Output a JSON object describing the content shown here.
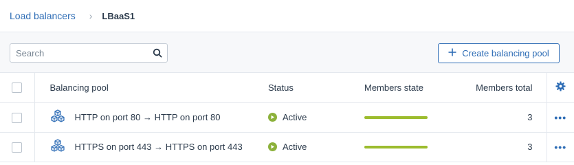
{
  "breadcrumb": {
    "parent": "Load balancers",
    "separator": "›",
    "current": "LBaaS1"
  },
  "toolbar": {
    "search_placeholder": "Search",
    "search_value": "",
    "create_label": "Create balancing pool"
  },
  "table": {
    "headers": {
      "pool": "Balancing pool",
      "status": "Status",
      "members_state": "Members state",
      "members_total": "Members total"
    },
    "rows": [
      {
        "pool": "HTTP on port 80 → HTTP on port 80",
        "status": "Active",
        "members_state": 1.0,
        "members_total": "3"
      },
      {
        "pool": "HTTPS on port 443 → HTTPS on port 443",
        "status": "Active",
        "members_state": 1.0,
        "members_total": "3"
      }
    ]
  },
  "colors": {
    "accent": "#2d6cb5",
    "status_active": "#8cb13b",
    "members_bar": "#9cbc2e"
  },
  "icons": {
    "search": "search-icon",
    "create": "plus-icon",
    "settings": "gear-icon",
    "pool": "cubes-icon",
    "status": "play-icon",
    "row_menu": "more-icon"
  }
}
